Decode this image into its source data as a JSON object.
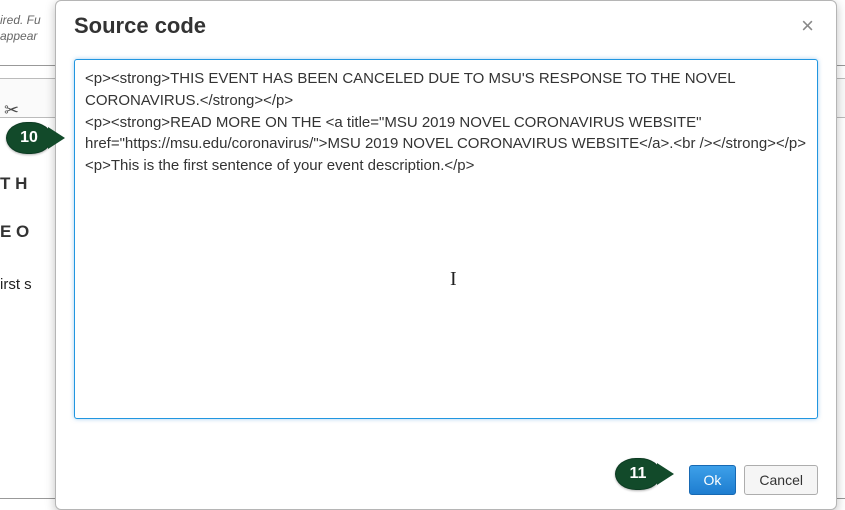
{
  "background": {
    "hint_line1": "ired. Fu",
    "hint_line2": "appear",
    "heading1_fragment": "T H",
    "heading2_fragment": "E O",
    "paragraph_fragment": "irst s"
  },
  "dialog": {
    "title": "Source code",
    "close_label": "×",
    "textarea_value": "<p><strong>THIS EVENT HAS BEEN CANCELED DUE TO MSU'S RESPONSE TO THE NOVEL CORONAVIRUS.</strong></p>\n<p><strong>READ MORE ON THE <a title=\"MSU 2019 NOVEL CORONAVIRUS WEBSITE\" href=\"https://msu.edu/coronavirus/\">MSU 2019 NOVEL CORONAVIRUS WEBSITE</a>.<br /></strong></p>\n<p>This is the first sentence of your event description.</p>",
    "ok_label": "Ok",
    "cancel_label": "Cancel"
  },
  "callouts": {
    "step10": "10",
    "step11": "11"
  }
}
